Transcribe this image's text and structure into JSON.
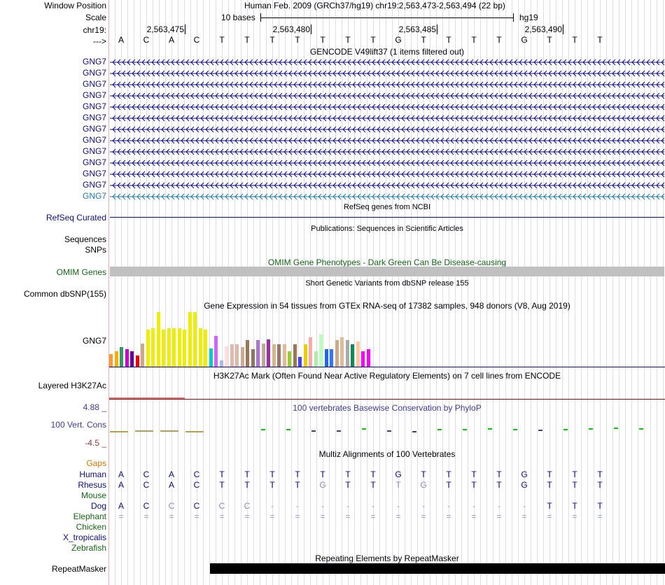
{
  "header": {
    "window_position_label": "Window Position",
    "window_position_value": "Human Feb. 2009 (GRCh37/hg19)   chr19:2,563,473-2,563,494 (22 bp)",
    "scale_label": "Scale",
    "scale_value": "10 bases",
    "assembly": "hg19",
    "chrom_label": "chr19:",
    "strand_label": "--->",
    "positions": [
      "2,563,475",
      "2,563,480",
      "2,563,485",
      "2,563,490"
    ],
    "bases": [
      "A",
      "C",
      "A",
      "C",
      "T",
      "T",
      "T",
      "T",
      "T",
      "T",
      "T",
      "G",
      "T",
      "T",
      "T",
      "T",
      "G",
      "T",
      "T",
      "T"
    ]
  },
  "gencode": {
    "title": "GENCODE V49lift37 (1 items filtered out)",
    "genes": [
      "GNG7",
      "GNG7",
      "GNG7",
      "GNG7",
      "GNG7",
      "GNG7",
      "GNG7",
      "GNG7",
      "GNG7",
      "GNG7",
      "GNG7",
      "GNG7"
    ],
    "last_gene": "GNG7",
    "gene_color": "#0c0c78",
    "last_gene_color": "#1e78a0"
  },
  "refseq": {
    "label": "RefSeq Curated",
    "title": "RefSeq genes from NCBI",
    "color": "#0c0c78"
  },
  "publications": {
    "title": "Publications: Sequences in Scientific Articles",
    "sequences_label": "Sequences",
    "snps_label": "SNPs"
  },
  "omim": {
    "title": "OMIM Gene Phenotypes - Dark Green Can Be Disease-causing",
    "label": "OMIM Genes",
    "color": "#146414"
  },
  "dbsnp": {
    "title": "Short Genetic Variants from dbSNP release 155",
    "label": "Common dbSNP(155)"
  },
  "gtex": {
    "title": "Gene Expression in 54 tissues from GTEx RNA-seq of 17382 samples, 948 donors (V8, Aug 2019)",
    "gene_label": "GNG7",
    "tissues": [
      {
        "value": 0.23,
        "color": "#ff9933"
      },
      {
        "value": 0.27,
        "color": "#ffaa00"
      },
      {
        "value": 0.35,
        "color": "#339966"
      },
      {
        "value": 0.31,
        "color": "#cc00cc"
      },
      {
        "value": 0.27,
        "color": "#660099"
      },
      {
        "value": 0.2,
        "color": "#ee0000"
      },
      {
        "value": 0.41,
        "color": "#ccaa88"
      },
      {
        "value": 0.66,
        "color": "#eeee00"
      },
      {
        "value": 0.69,
        "color": "#eeee00"
      },
      {
        "value": 0.97,
        "color": "#eeee00"
      },
      {
        "value": 0.66,
        "color": "#eeee00"
      },
      {
        "value": 0.69,
        "color": "#eeee00"
      },
      {
        "value": 0.69,
        "color": "#eeee00"
      },
      {
        "value": 0.69,
        "color": "#eeee00"
      },
      {
        "value": 0.66,
        "color": "#eeee00"
      },
      {
        "value": 0.97,
        "color": "#eeee00"
      },
      {
        "value": 0.97,
        "color": "#eeee00"
      },
      {
        "value": 0.69,
        "color": "#eeee00"
      },
      {
        "value": 0.66,
        "color": "#eeee00"
      },
      {
        "value": 0.33,
        "color": "#00cccc"
      },
      {
        "value": 0.55,
        "color": "#cc66ff"
      },
      {
        "value": 0.11,
        "color": "#aabbdd"
      },
      {
        "value": 0.36,
        "color": "#ffdddd"
      },
      {
        "value": 0.4,
        "color": "#ddbbaa"
      },
      {
        "value": 0.4,
        "color": "#ddbbaa"
      },
      {
        "value": 0.35,
        "color": "#ccaa99"
      },
      {
        "value": 0.47,
        "color": "#997755"
      },
      {
        "value": 0.31,
        "color": "#887766"
      },
      {
        "value": 0.48,
        "color": "#aa77cc"
      },
      {
        "value": 0.41,
        "color": "#bbaa99"
      },
      {
        "value": 0.49,
        "color": "#993399"
      },
      {
        "value": 0.4,
        "color": "#d4b88c"
      },
      {
        "value": 0.4,
        "color": "#997766"
      },
      {
        "value": 0.4,
        "color": "#ddbb99"
      },
      {
        "value": 0.28,
        "color": "#99cc33"
      },
      {
        "value": 0.4,
        "color": "#997755"
      },
      {
        "value": 0.17,
        "color": "#4444ee"
      },
      {
        "value": 0.4,
        "color": "#eecc00"
      },
      {
        "value": 0.52,
        "color": "#ffaaaa"
      },
      {
        "value": 0.28,
        "color": "#aaeeaa"
      },
      {
        "value": 0.57,
        "color": "#bbffbb"
      },
      {
        "value": 0.31,
        "color": "#2266ee"
      },
      {
        "value": 0.31,
        "color": "#3377ff"
      },
      {
        "value": 0.48,
        "color": "#ccaa88"
      },
      {
        "value": 0.52,
        "color": "#ddbb99"
      },
      {
        "value": 0.48,
        "color": "#aaaaaa"
      },
      {
        "value": 0.4,
        "color": "#118855"
      },
      {
        "value": 0.45,
        "color": "#ffcc99"
      },
      {
        "value": 0.28,
        "color": "#ff00ff"
      },
      {
        "value": 0.31,
        "color": "#ff00ff"
      }
    ]
  },
  "h3k27ac": {
    "label": "Layered H3K27Ac",
    "title": "H3K27Ac Mark (Often Found Near Active Regulatory Elements) on 7 cell lines from ENCODE"
  },
  "phylop": {
    "title": "100 vertebrates Basewise Conservation by PhyloP",
    "label": "100 Vert. Cons",
    "max_label": "4.88 _",
    "min_label": "-4.5 _",
    "title_color": "#3c3c8c",
    "max_color": "#3c3c8c",
    "min_color": "#8c3c3c",
    "scores": [
      -0.6,
      -0.3,
      -0.2,
      -0.4,
      0,
      0,
      0.2,
      0.3,
      -0.2,
      -0.2,
      0.4,
      -0.3,
      -0.4,
      0.3,
      0.3,
      0.4,
      0.2,
      -0.1,
      0.3,
      0.6,
      0.7,
      0.5
    ]
  },
  "multiz": {
    "title": "Multiz Alignments of 100 Vertebrates",
    "gaps_label": "Gaps",
    "species": [
      {
        "name": "Human",
        "seq": [
          "A",
          "C",
          "A",
          "C",
          "T",
          "T",
          "T",
          "T",
          "T",
          "T",
          "T",
          "G",
          "T",
          "T",
          "T",
          "T",
          "G",
          "T",
          "T",
          "T"
        ],
        "color": "#0c0c78"
      },
      {
        "name": "Rhesus",
        "seq": [
          "A",
          "C",
          "A",
          "C",
          "T",
          "T",
          "T",
          "T",
          "G",
          "T",
          "T",
          "T",
          "G",
          "T",
          "T",
          "T",
          "G",
          "T",
          "T",
          "T"
        ],
        "color": "#0c0c78"
      },
      {
        "name": "Mouse",
        "seq": [],
        "color": "#146414"
      },
      {
        "name": "Dog",
        "seq": [
          "A",
          "C",
          "C",
          "C",
          "C",
          "C",
          "-",
          "-",
          "-",
          "-",
          "-",
          "-",
          "-",
          "-",
          "-",
          "-",
          "-",
          "T",
          "T",
          "T"
        ],
        "color": "#0c0c78"
      },
      {
        "name": "Elephant",
        "seq": [
          "=",
          "=",
          "=",
          "=",
          "=",
          "=",
          "=",
          "=",
          "=",
          "=",
          "=",
          "=",
          "=",
          "=",
          "=",
          "=",
          "=",
          "=",
          "=",
          "="
        ],
        "color": "#146414"
      },
      {
        "name": "Chicken",
        "seq": [],
        "color": "#146414"
      },
      {
        "name": "X_tropicalis",
        "seq": [],
        "color": "#0c0c78"
      },
      {
        "name": "Zebrafish",
        "seq": [],
        "color": "#146414"
      }
    ]
  },
  "repeatmasker": {
    "title": "Repeating Elements by RepeatMasker",
    "label": "RepeatMasker"
  }
}
